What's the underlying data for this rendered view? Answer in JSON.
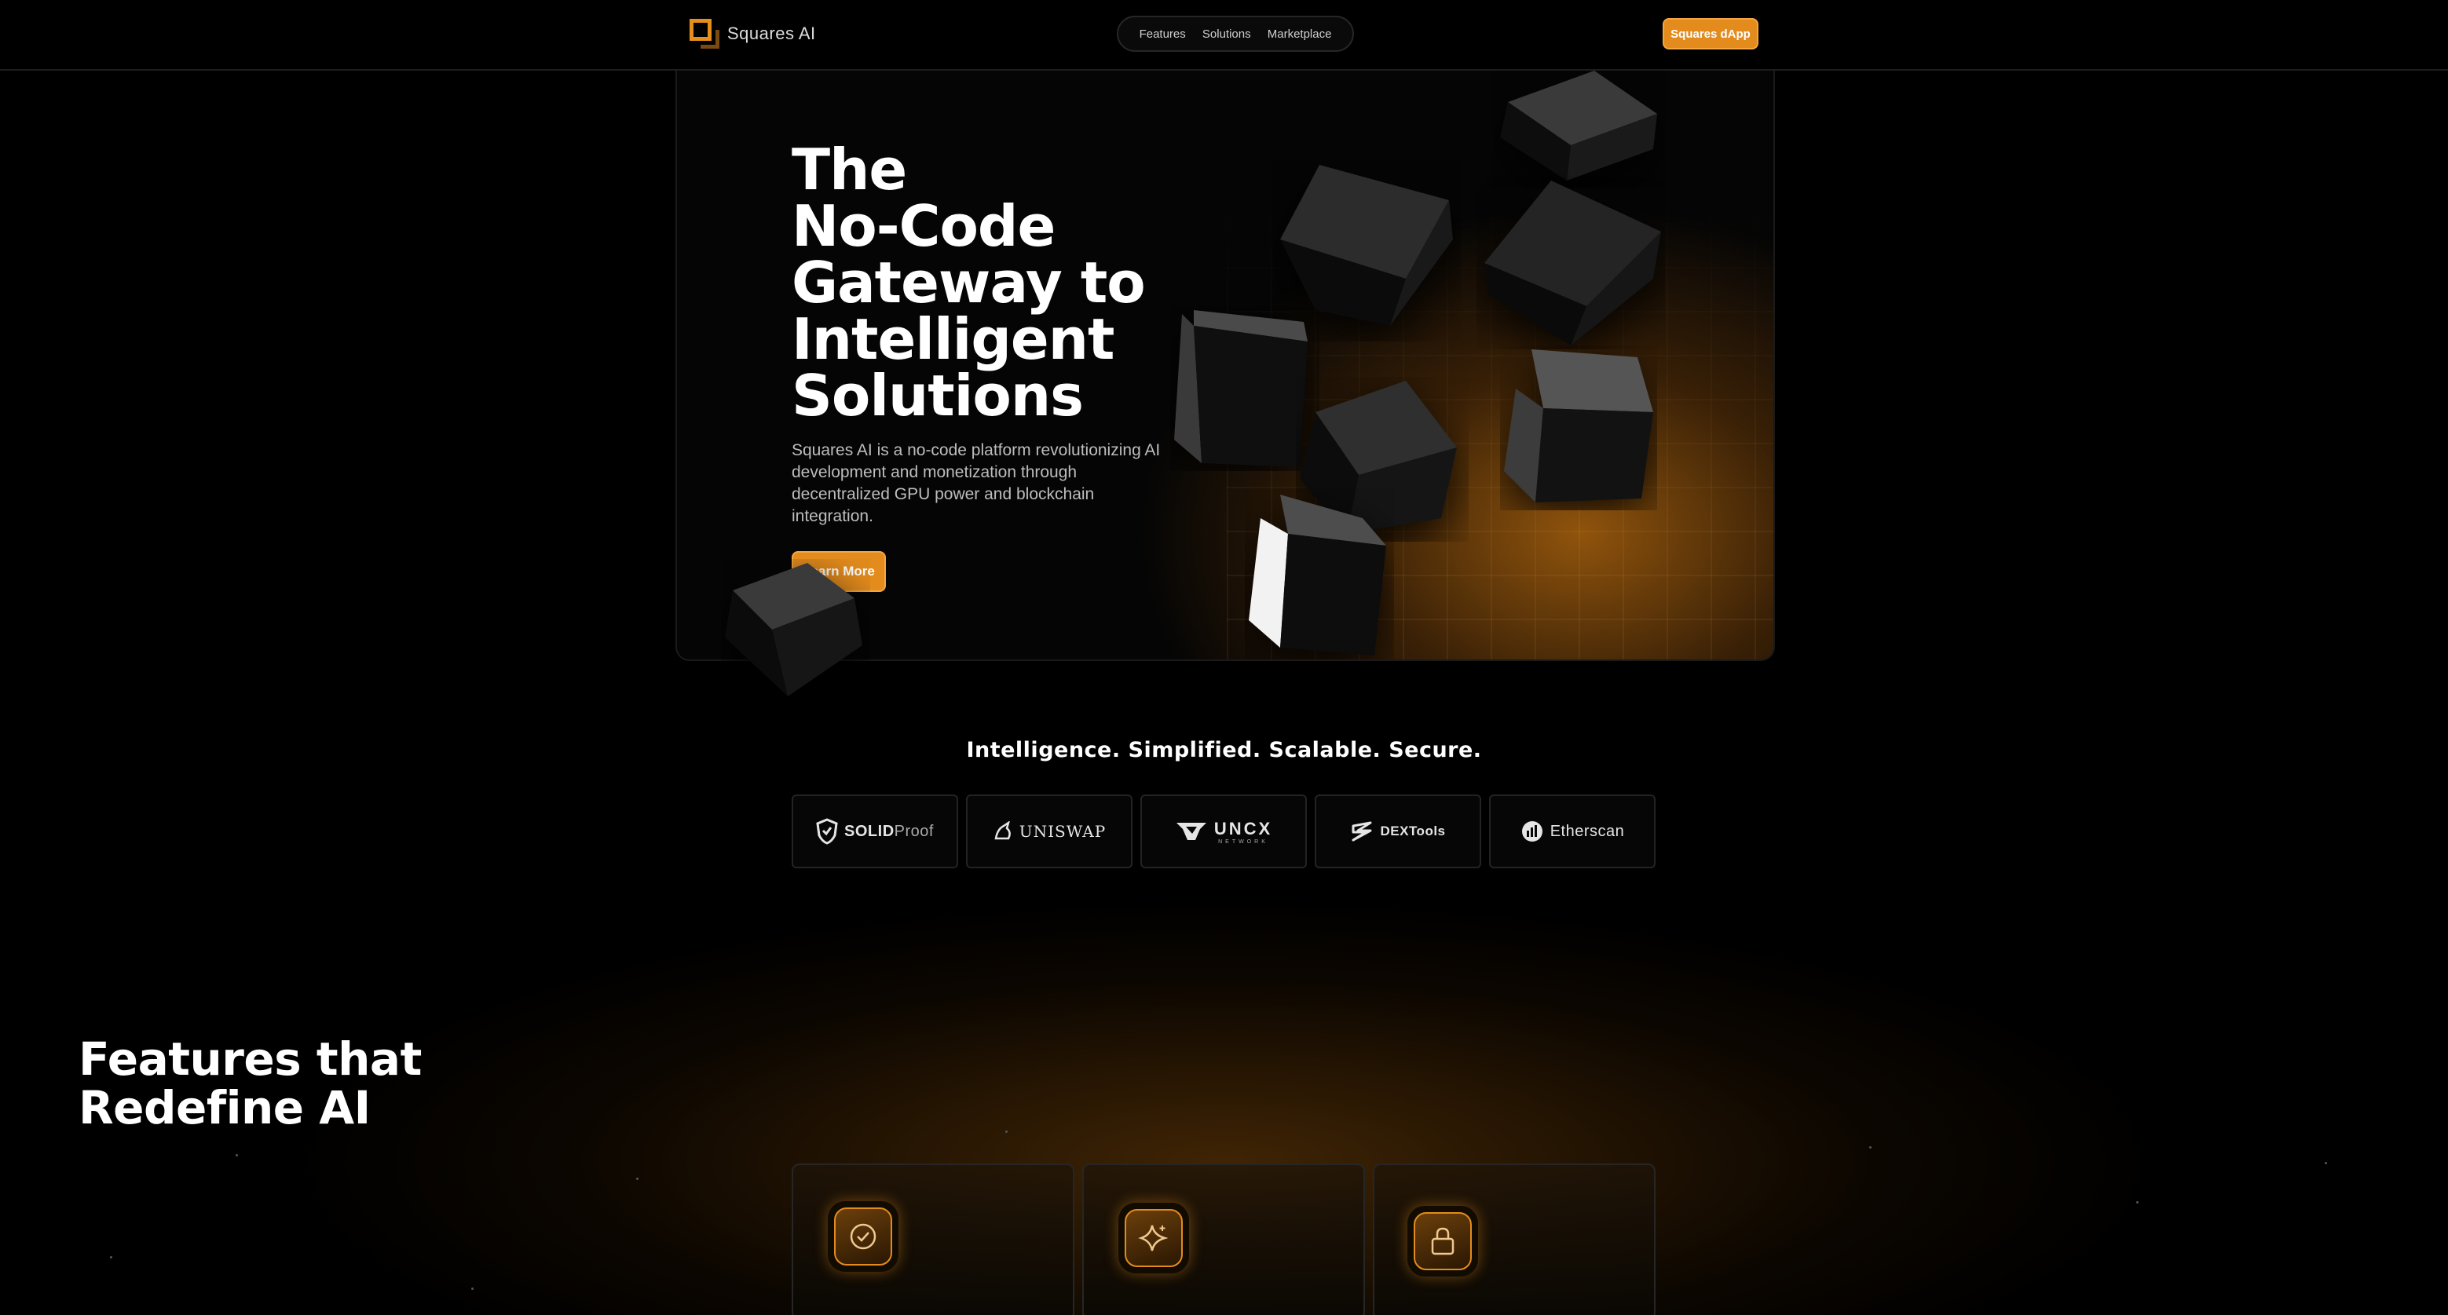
{
  "nav": {
    "brand": "Squares AI",
    "links": [
      "Features",
      "Solutions",
      "Marketplace"
    ],
    "cta": "Squares dApp"
  },
  "hero": {
    "title_lines": [
      "The",
      "No-Code",
      "Gateway to",
      "Intelligent",
      "Solutions"
    ],
    "description": "Squares AI is a no-code platform revolutionizing AI development and monetization through decentralized GPU power and blockchain integration.",
    "button": "Learn More"
  },
  "tagline": "Intelligence. Simplified. Scalable. Secure.",
  "partners": [
    {
      "name_bold": "SOLID",
      "name_light": "Proof",
      "icon": "shield-icon"
    },
    {
      "name_bold": "UNISWAP",
      "icon": "unicorn-icon"
    },
    {
      "name_bold": "UNCX",
      "sub": "NETWORK",
      "icon": "uncx-logo-icon"
    },
    {
      "name_bold": "DEXTools",
      "icon": "dextools-logo-icon"
    },
    {
      "name_bold": "Etherscan",
      "icon": "etherscan-logo-icon"
    }
  ],
  "features": {
    "title_lines": [
      "Features that",
      "Redefine AI"
    ],
    "cards": [
      {
        "icon": "check-circle-icon"
      },
      {
        "icon": "sparkle-icon"
      },
      {
        "icon": "lock-icon"
      }
    ]
  },
  "colors": {
    "accent": "#e38c1d",
    "accent_light": "#f3a642",
    "background": "#000000"
  }
}
